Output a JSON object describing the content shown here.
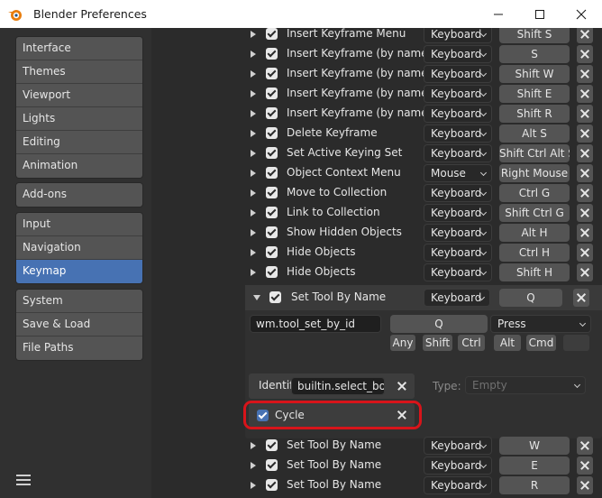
{
  "window": {
    "title": "Blender Preferences",
    "minimize_icon": "minimize-icon",
    "maximize_icon": "maximize-icon",
    "close_icon": "close-icon"
  },
  "sidebar": {
    "groups": [
      [
        "Interface",
        "Themes",
        "Viewport",
        "Lights",
        "Editing",
        "Animation"
      ],
      [
        "Add-ons"
      ],
      [
        "Input",
        "Navigation",
        "Keymap"
      ],
      [
        "System",
        "Save & Load",
        "File Paths"
      ]
    ],
    "active": "Keymap",
    "menu_icon": "hamburger-menu-icon"
  },
  "keymap_items_top": [
    {
      "name": "Insert Keyframe Menu",
      "type": "Keyboard",
      "key": "Shift S"
    },
    {
      "name": "Insert Keyframe (by name)",
      "type": "Keyboard",
      "key": "S"
    },
    {
      "name": "Insert Keyframe (by name)",
      "type": "Keyboard",
      "key": "Shift W"
    },
    {
      "name": "Insert Keyframe (by name)",
      "type": "Keyboard",
      "key": "Shift E"
    },
    {
      "name": "Insert Keyframe (by name)",
      "type": "Keyboard",
      "key": "Shift R"
    },
    {
      "name": "Delete Keyframe",
      "type": "Keyboard",
      "key": "Alt S"
    },
    {
      "name": "Set Active Keying Set",
      "type": "Keyboard",
      "key": "Shift Ctrl Alt S"
    },
    {
      "name": "Object Context Menu",
      "type": "Mouse",
      "key": "Right Mouse"
    },
    {
      "name": "Move to Collection",
      "type": "Keyboard",
      "key": "Ctrl G"
    },
    {
      "name": "Link to Collection",
      "type": "Keyboard",
      "key": "Shift Ctrl G"
    },
    {
      "name": "Show Hidden Objects",
      "type": "Keyboard",
      "key": "Alt H"
    },
    {
      "name": "Hide Objects",
      "type": "Keyboard",
      "key": "Ctrl H"
    },
    {
      "name": "Hide Objects",
      "type": "Keyboard",
      "key": "Shift H"
    }
  ],
  "expanded_item": {
    "name": "Set Tool By Name",
    "type": "Keyboard",
    "key": "Q",
    "operator_id": "wm.tool_set_by_id",
    "event_key": "Q",
    "event_value": "Press",
    "modifiers": [
      "Any",
      "Shift",
      "Ctrl",
      "Alt",
      "Cmd"
    ],
    "identifier_label": "Identifi",
    "identifier_value": "builtin.select_box",
    "type_label": "Type:",
    "type_value": "Empty",
    "cycle_label": "Cycle"
  },
  "keymap_items_bottom": [
    {
      "name": "Set Tool By Name",
      "type": "Keyboard",
      "key": "W"
    },
    {
      "name": "Set Tool By Name",
      "type": "Keyboard",
      "key": "E"
    },
    {
      "name": "Set Tool By Name",
      "type": "Keyboard",
      "key": "R"
    }
  ],
  "colors": {
    "accent": "#4772b3",
    "annotation": "#d8141a"
  }
}
